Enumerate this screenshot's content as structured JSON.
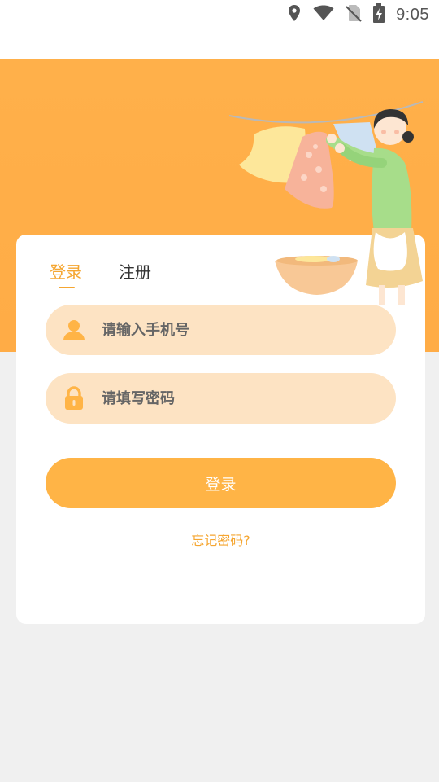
{
  "status_bar": {
    "time": "9:05",
    "icons": [
      "location-icon",
      "wifi-icon",
      "no-sim-icon",
      "battery-charging-icon"
    ]
  },
  "tabs": {
    "login_label": "登录",
    "register_label": "注册",
    "active": "login"
  },
  "form": {
    "phone_placeholder": "请输入手机号",
    "password_placeholder": "请填写密码",
    "submit_label": "登录",
    "forgot_label": "忘记密码?"
  },
  "colors": {
    "accent": "#f5a631",
    "hero_bg": "#ffb04a",
    "field_bg": "#fde3c3",
    "button_bg": "#ffb446",
    "page_bg": "#f0f0f0"
  },
  "illustration": {
    "subject": "woman-hanging-laundry-illustration"
  }
}
